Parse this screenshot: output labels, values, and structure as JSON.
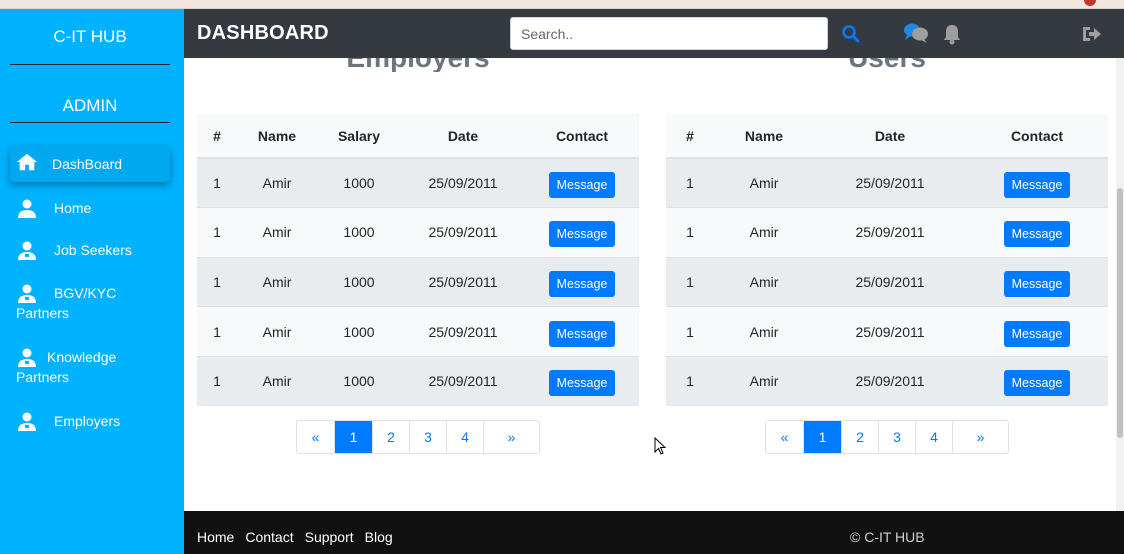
{
  "sidebar": {
    "brand": "C-IT HUB",
    "role": "ADMIN",
    "items": [
      {
        "label": "DashBoard",
        "label2": "",
        "icon": "home-icon"
      },
      {
        "label": "Home",
        "label2": "",
        "icon": "user-icon"
      },
      {
        "label": "Job Seekers",
        "label2": "",
        "icon": "users-icon"
      },
      {
        "label": "BGV/KYC",
        "label2": "Partners",
        "icon": "users-icon"
      },
      {
        "label": "Knowledge",
        "label2": "Partners",
        "icon": "users-icon"
      },
      {
        "label": "Employers",
        "label2": "",
        "icon": "users-icon"
      }
    ]
  },
  "header": {
    "title": "DASHBOARD",
    "search_placeholder": "Search..",
    "icons": [
      "search-icon",
      "chat-icon",
      "bell-icon",
      "logout-icon"
    ]
  },
  "employers": {
    "title": "Employers",
    "columns": [
      "#",
      "Name",
      "Salary",
      "Date",
      "Contact"
    ],
    "rows": [
      {
        "num": "1",
        "name": "Amir",
        "salary": "1000",
        "date": "25/09/2011",
        "action": "Message"
      },
      {
        "num": "1",
        "name": "Amir",
        "salary": "1000",
        "date": "25/09/2011",
        "action": "Message"
      },
      {
        "num": "1",
        "name": "Amir",
        "salary": "1000",
        "date": "25/09/2011",
        "action": "Message"
      },
      {
        "num": "1",
        "name": "Amir",
        "salary": "1000",
        "date": "25/09/2011",
        "action": "Message"
      },
      {
        "num": "1",
        "name": "Amir",
        "salary": "1000",
        "date": "25/09/2011",
        "action": "Message"
      }
    ],
    "pagination": [
      "«",
      "1",
      "2",
      "3",
      "4",
      "»"
    ],
    "active_page": "1"
  },
  "users": {
    "title": "Users",
    "columns": [
      "#",
      "Name",
      "Date",
      "Contact"
    ],
    "rows": [
      {
        "num": "1",
        "name": "Amir",
        "date": "25/09/2011",
        "action": "Message"
      },
      {
        "num": "1",
        "name": "Amir",
        "date": "25/09/2011",
        "action": "Message"
      },
      {
        "num": "1",
        "name": "Amir",
        "date": "25/09/2011",
        "action": "Message"
      },
      {
        "num": "1",
        "name": "Amir",
        "date": "25/09/2011",
        "action": "Message"
      },
      {
        "num": "1",
        "name": "Amir",
        "date": "25/09/2011",
        "action": "Message"
      }
    ],
    "pagination": [
      "«",
      "1",
      "2",
      "3",
      "4",
      "»"
    ],
    "active_page": "1"
  },
  "footer": {
    "links": [
      "Home",
      "Contact",
      "Support",
      "Blog"
    ],
    "copyright": "© C-IT HUB"
  },
  "colors": {
    "sidebar_bg": "#00b2ff",
    "topbar_bg": "#343a40",
    "primary": "#007bff",
    "footer_bg": "#111111"
  }
}
